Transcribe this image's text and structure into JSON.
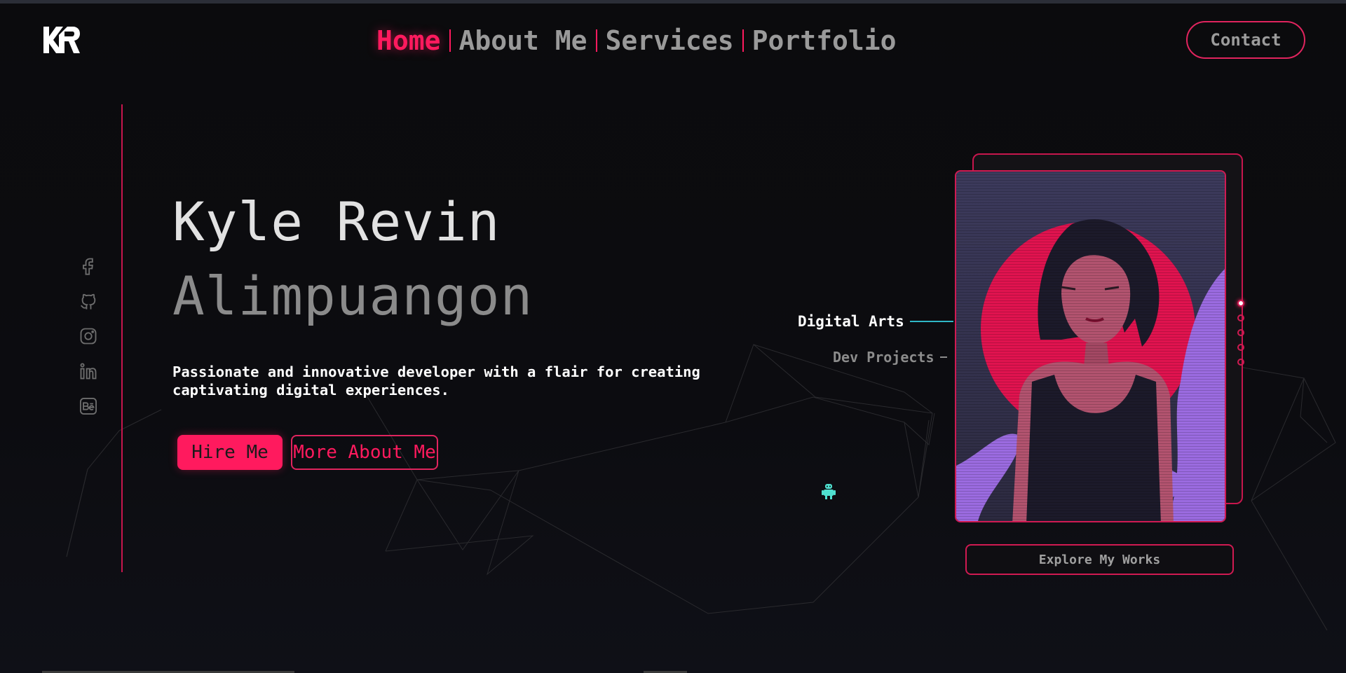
{
  "header": {
    "logo_text": "KR",
    "nav": [
      {
        "label": "Home",
        "active": true
      },
      {
        "label": "About Me",
        "active": false
      },
      {
        "label": "Services",
        "active": false
      },
      {
        "label": "Portfolio",
        "active": false
      }
    ],
    "contact_label": "Contact"
  },
  "social_icons": [
    "facebook-icon",
    "github-icon",
    "instagram-icon",
    "linkedin-icon",
    "behance-icon"
  ],
  "hero": {
    "first_line": "Kyle Revin",
    "second_line": "Alimpuangon",
    "tagline": "Passionate and innovative developer with a flair for creating captivating digital experiences.",
    "hire_label": "Hire Me",
    "more_label": "More About Me"
  },
  "showcase": {
    "categories": [
      {
        "label": "Digital Arts",
        "active": true
      },
      {
        "label": "Dev Projects",
        "active": false
      }
    ],
    "slides_total": 5,
    "active_slide": 1,
    "explore_label": "Explore My Works"
  },
  "colors": {
    "accent": "#ff1a5e",
    "background": "#0b0b0d",
    "teal": "#2fb7c6"
  }
}
